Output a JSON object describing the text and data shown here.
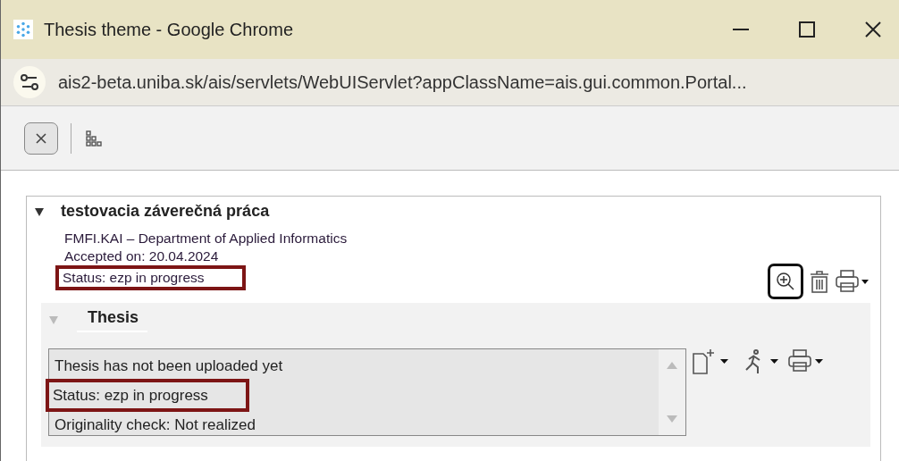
{
  "window": {
    "title": "Thesis theme - Google Chrome"
  },
  "address_bar": {
    "url": "ais2-beta.uniba.sk/ais/servlets/WebUIServlet?appClassName=ais.gui.common.Portal..."
  },
  "thesis": {
    "title": "testovacia záverečná práca",
    "expanded": true,
    "lines": [
      {
        "text": "FMFI.KAI – Department of Applied Informatics",
        "highlighted": false
      },
      {
        "text": "Accepted on: 20.04.2024",
        "highlighted": false
      },
      {
        "text": "Status: ezp in progress",
        "highlighted": true
      }
    ],
    "section": {
      "title": "Thesis",
      "expanded": true,
      "lines": [
        {
          "text": "Thesis has not been uploaded yet",
          "highlighted": false
        },
        {
          "text": "Status: ezp in progress",
          "highlighted": true
        },
        {
          "text": "Originality check: Not realized",
          "highlighted": false
        }
      ]
    }
  }
}
